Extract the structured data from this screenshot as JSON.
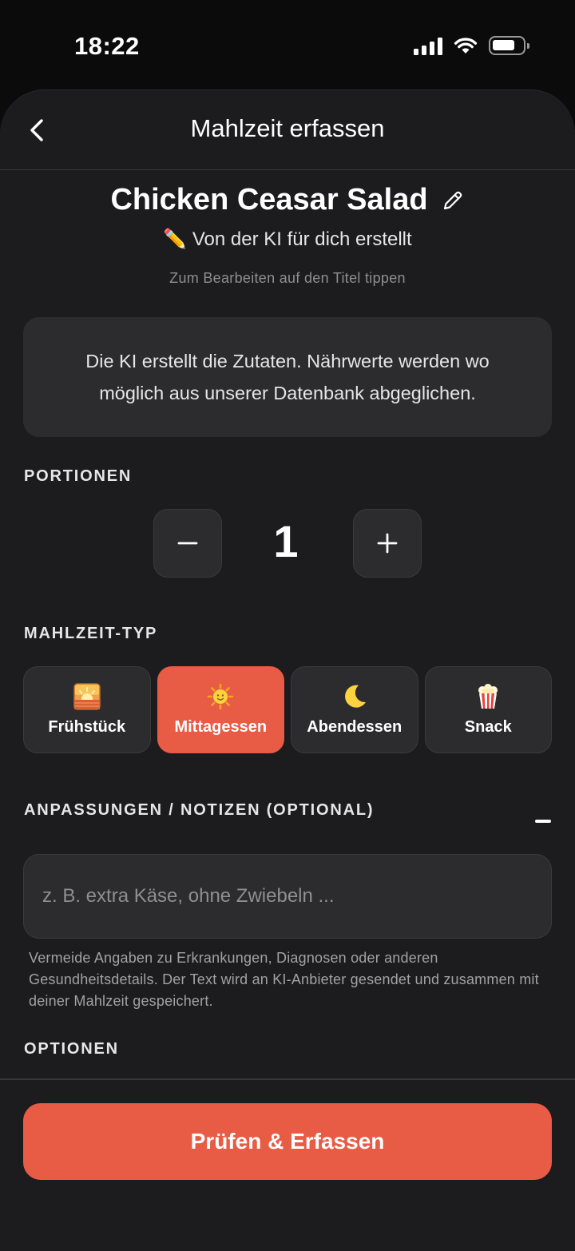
{
  "status_bar": {
    "time": "18:22"
  },
  "nav": {
    "title": "Mahlzeit erfassen"
  },
  "meal": {
    "title": "Chicken Ceasar Salad",
    "ai_subtitle": "✏️ Von der KI für dich erstellt",
    "edit_hint": "Zum Bearbeiten auf den Titel tippen"
  },
  "info_text": "Die KI erstellt die Zutaten. Nährwerte werden wo möglich aus unserer Datenbank abgeglichen.",
  "portions": {
    "label": "PORTIONEN",
    "value": "1",
    "minus_icon": "minus-icon",
    "plus_icon": "plus-icon"
  },
  "meal_type": {
    "label": "MAHLZEIT-TYP",
    "selected": "Mittagessen",
    "options": [
      {
        "label": "Frühstück",
        "icon": "sunrise-icon"
      },
      {
        "label": "Mittagessen",
        "icon": "sun-icon"
      },
      {
        "label": "Abendessen",
        "icon": "moon-icon"
      },
      {
        "label": "Snack",
        "icon": "popcorn-icon"
      }
    ]
  },
  "notes": {
    "label": "ANPASSUNGEN / NOTIZEN (OPTIONAL)",
    "value": "",
    "placeholder": "z. B. extra Käse, ohne Zwiebeln ...",
    "disclaimer": "Vermeide Angaben zu Erkrankungen, Diagnosen oder anderen Gesundheitsdetails. Der Text wird an KI-Anbieter gesendet und zusammen mit deiner Mahlzeit gespeichert."
  },
  "options": {
    "label": "OPTIONEN"
  },
  "submit": {
    "label": "Prüfen & Erfassen"
  },
  "colors": {
    "accent": "#e85b45",
    "background": "#1c1c1e",
    "card": "#2c2c2e"
  }
}
